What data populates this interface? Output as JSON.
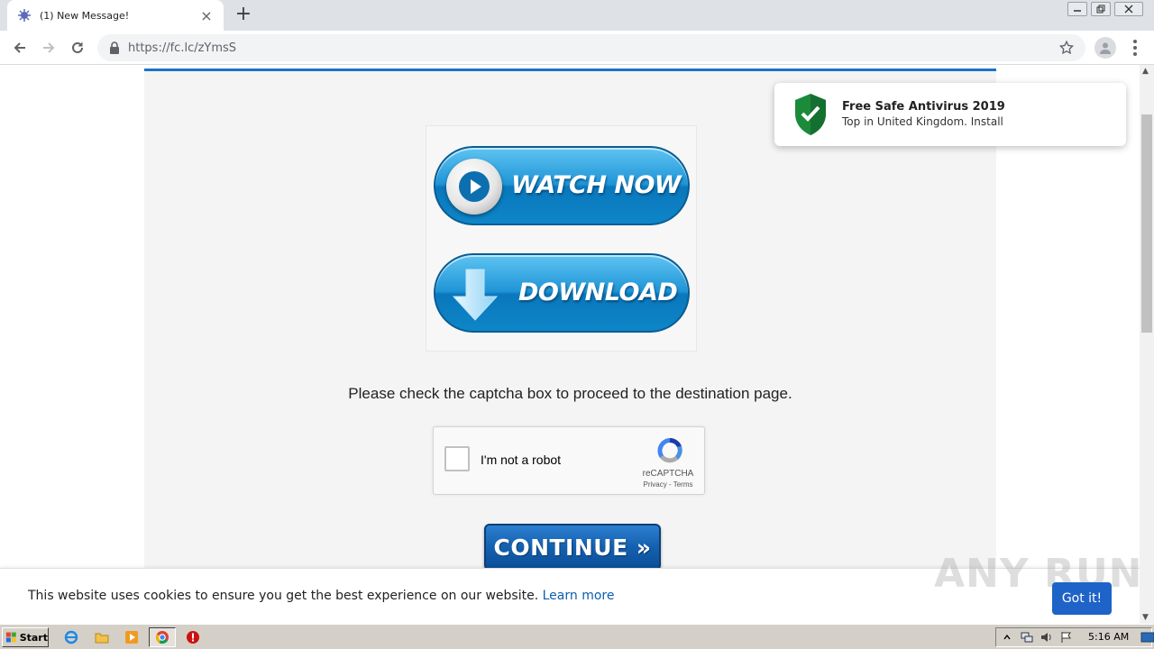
{
  "browser": {
    "tab": {
      "title": "(1) New Message!",
      "close": "×"
    },
    "new_tab": "+",
    "address": {
      "url": "https://fc.lc/zYmsS"
    }
  },
  "page": {
    "buttons": {
      "watch_now": "WATCH NOW",
      "download": "DOWNLOAD",
      "continue": "CONTINUE »"
    },
    "instruction": "Please check the captcha box to proceed to the destination page.",
    "recaptcha": {
      "label": "I'm not a robot",
      "brand": "reCAPTCHA",
      "links": "Privacy - Terms",
      "checked": false
    },
    "notification": {
      "title": "Free Safe Antivirus 2019",
      "subtitle": "Top in United Kingdom. Install"
    },
    "cookie_bar": {
      "text": "This website uses cookies to ensure you get the best experience on our website.",
      "link": "Learn more",
      "button": "Got it!"
    },
    "watermark": "ANY RUN"
  },
  "taskbar": {
    "start": "Start",
    "clock": "5:16 AM"
  },
  "colors": {
    "accent_blue": "#1a73c9",
    "button_blue": "#1f95d6",
    "cookie_button": "#1e63c7",
    "shield_green": "#1b8a3a"
  }
}
